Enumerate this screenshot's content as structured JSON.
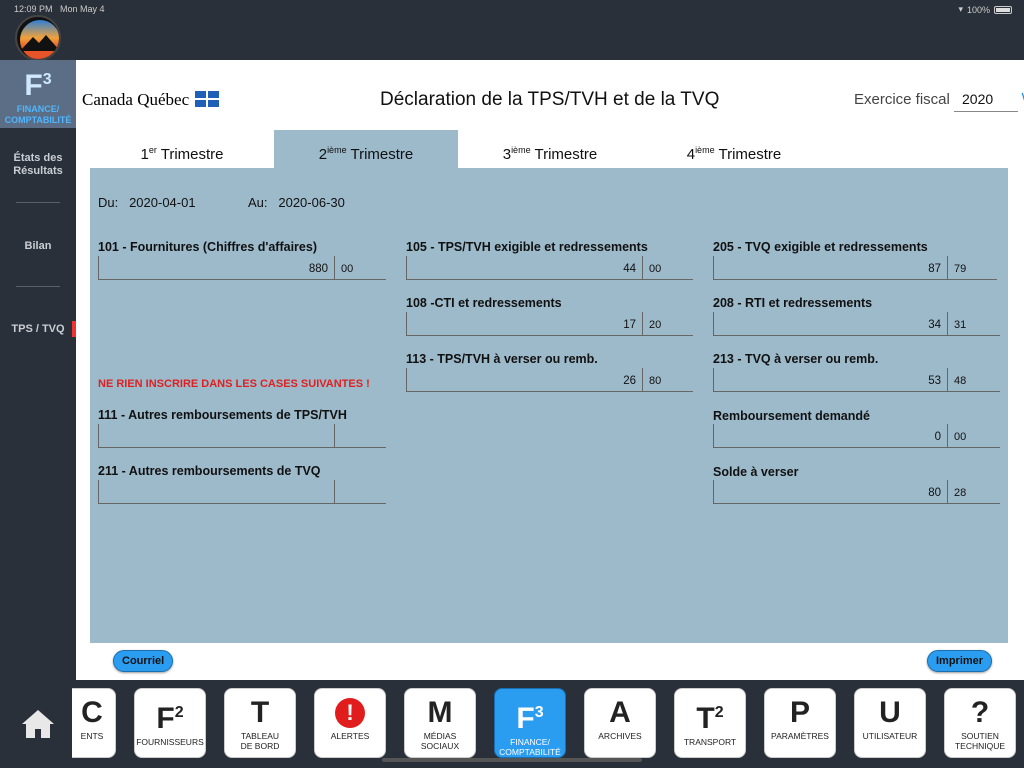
{
  "status": {
    "time": "12:09 PM",
    "date": "Mon May 4",
    "battery": "100%"
  },
  "sidebar": {
    "head_letter": "F",
    "head_sup": "3",
    "head_label_1": "FINANCE/",
    "head_label_2": "COMPTABILITÉ",
    "items": [
      {
        "label_1": "États des",
        "label_2": "Résultats"
      },
      {
        "label": "Bilan"
      },
      {
        "label": "TPS / TVQ"
      }
    ]
  },
  "header": {
    "brand_canada": "Canada",
    "brand_quebec": "Québec",
    "title": "Déclaration de la TPS/TVH et de la TVQ",
    "fiscal_label": "Exercice fiscal",
    "fiscal_year": "2020"
  },
  "tabs": [
    {
      "num": "1",
      "sup": "er",
      "label": "Trimestre"
    },
    {
      "num": "2",
      "sup": "ième",
      "label": "Trimestre"
    },
    {
      "num": "3",
      "sup": "ième",
      "label": "Trimestre"
    },
    {
      "num": "4",
      "sup": "ième",
      "label": "Trimestre"
    }
  ],
  "period": {
    "du_label": "Du:",
    "du": "2020-04-01",
    "au_label": "Au:",
    "au": "2020-06-30"
  },
  "fields": {
    "f101": {
      "label": "101 - Fournitures (Chiffres d'affaires)",
      "dollars": "880",
      "cents": "00"
    },
    "f105": {
      "label": "105 - TPS/TVH exigible et redressements",
      "dollars": "44",
      "cents": "00"
    },
    "f205": {
      "label": "205 - TVQ exigible et redressements",
      "dollars": "87",
      "cents": "79"
    },
    "f108": {
      "label": "108 -CTI et redressements",
      "dollars": "17",
      "cents": "20"
    },
    "f208": {
      "label": "208 - RTI et redressements",
      "dollars": "34",
      "cents": "31"
    },
    "f113": {
      "label": "113 - TPS/TVH à verser ou remb.",
      "dollars": "26",
      "cents": "80"
    },
    "f213": {
      "label": "213 - TVQ à verser ou remb.",
      "dollars": "53",
      "cents": "48"
    },
    "f111": {
      "label": "111 - Autres remboursements de TPS/TVH",
      "dollars": "",
      "cents": ""
    },
    "f211": {
      "label": "211 - Autres remboursements de TVQ",
      "dollars": "",
      "cents": ""
    },
    "refund": {
      "label": "Remboursement demandé",
      "dollars": "0",
      "cents": "00"
    },
    "balance": {
      "label": "Solde à verser",
      "dollars": "80",
      "cents": "28"
    }
  },
  "warning": "NE RIEN INSCRIRE DANS LES CASES SUIVANTES !",
  "buttons": {
    "email": "Courriel",
    "print": "Imprimer"
  },
  "dock": [
    {
      "letter": "C",
      "sup": "",
      "label_1": "ENTS",
      "label_2": ""
    },
    {
      "letter": "F",
      "sup": "2",
      "label_1": "FOURNISSEURS",
      "label_2": ""
    },
    {
      "letter": "T",
      "sup": "",
      "label_1": "TABLEAU",
      "label_2": "DE BORD"
    },
    {
      "letter": "!",
      "sup": "",
      "label_1": "ALERTES",
      "label_2": ""
    },
    {
      "letter": "M",
      "sup": "",
      "label_1": "MÉDIAS",
      "label_2": "SOCIAUX"
    },
    {
      "letter": "F",
      "sup": "3",
      "label_1": "FINANCE/",
      "label_2": "COMPTABILITÉ"
    },
    {
      "letter": "A",
      "sup": "",
      "label_1": "ARCHIVES",
      "label_2": ""
    },
    {
      "letter": "T",
      "sup": "2",
      "label_1": "TRANSPORT",
      "label_2": ""
    },
    {
      "letter": "P",
      "sup": "",
      "label_1": "PARAMÈTRES",
      "label_2": ""
    },
    {
      "letter": "U",
      "sup": "",
      "label_1": "UTILISATEUR",
      "label_2": ""
    },
    {
      "letter": "?",
      "sup": "",
      "label_1": "SOUTIEN",
      "label_2": "TECHNIQUE"
    }
  ],
  "colors": {
    "accent": "#2a9df0",
    "panel": "#9dbacb",
    "sidebar": "#2a3039",
    "warning": "#e02020"
  }
}
